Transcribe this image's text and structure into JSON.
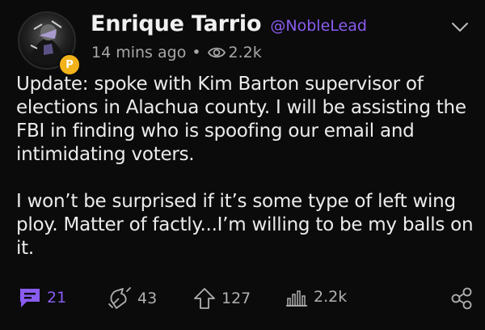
{
  "post": {
    "author": {
      "display_name": "Enrique Tarrio",
      "handle": "@NobleLead",
      "badge_letter": "P",
      "badge_color": "#f2b21a",
      "handle_color": "#8a5cf0"
    },
    "meta": {
      "time": "14 mins ago",
      "separator": "•",
      "views": "2.2k"
    },
    "body": {
      "paragraph_1": "Update: spoke with Kim Barton supervisor of elections in Alachua county. I will be assisting the FBI in finding who is spoofing our email and intimidating voters.",
      "paragraph_2": "I won’t be surprised if it’s some type of left wing ploy. Matter of factly...I’m willing to be my balls on it."
    },
    "actions": {
      "comments": "21",
      "echoes": "43",
      "upvotes": "127",
      "views": "2.2k"
    },
    "icons": {
      "eye": "eye-icon",
      "chevron": "chevron-down-icon",
      "comment": "comment-icon",
      "echo": "echo-icon",
      "upvote": "upvote-arrow-icon",
      "views": "bar-chart-icon",
      "share": "share-icon"
    }
  }
}
